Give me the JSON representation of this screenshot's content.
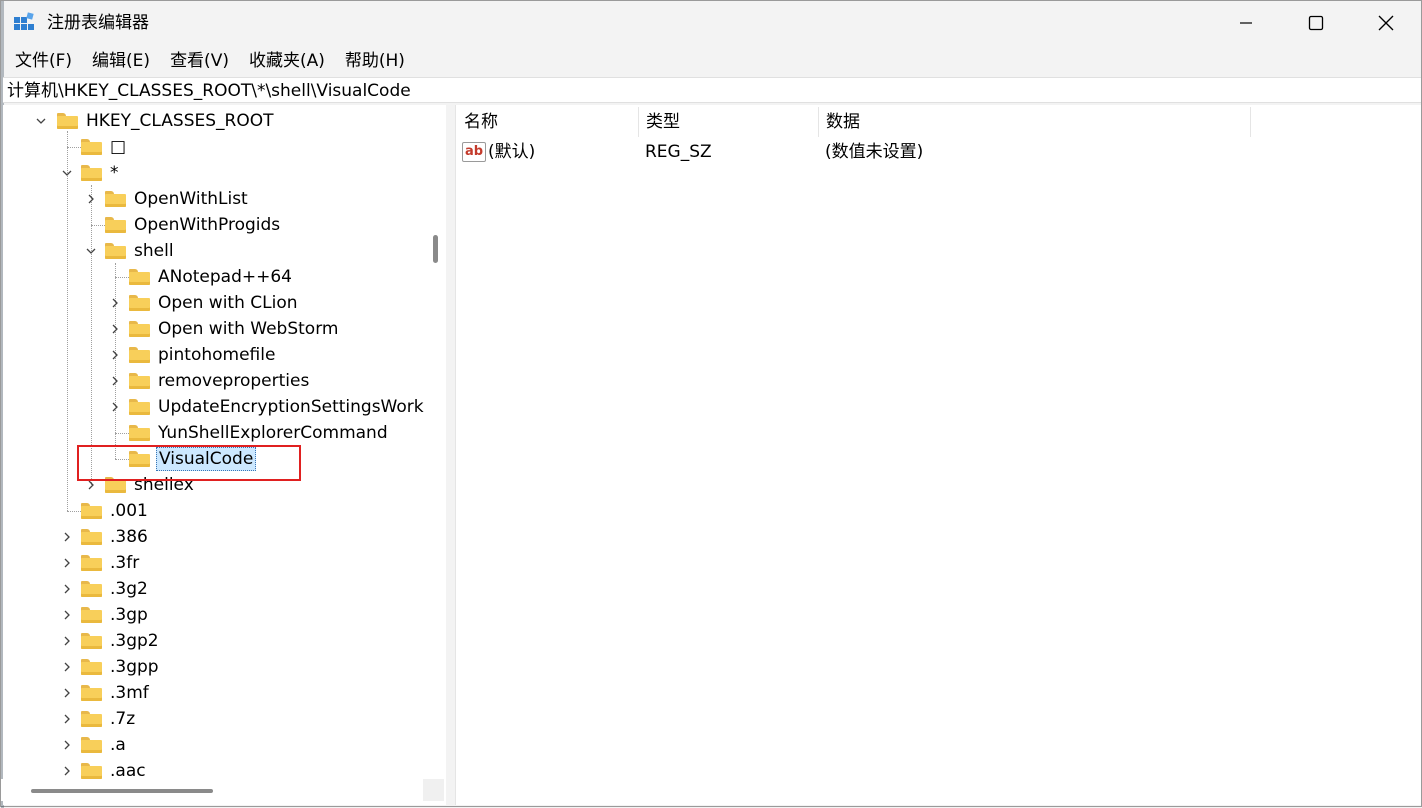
{
  "window": {
    "title": "注册表编辑器",
    "icon": "regedit-icon"
  },
  "menu": [
    "文件(F)",
    "编辑(E)",
    "查看(V)",
    "收藏夹(A)",
    "帮助(H)"
  ],
  "address": "计算机\\HKEY_CLASSES_ROOT\\*\\shell\\VisualCode",
  "tree": {
    "root": "HKEY_CLASSES_ROOT",
    "nodes": [
      {
        "label": "□",
        "expander": "none"
      },
      {
        "label": "*",
        "expander": "expanded"
      },
      {
        "label": "OpenWithList",
        "expander": "collapsed"
      },
      {
        "label": "OpenWithProgids",
        "expander": "none"
      },
      {
        "label": "shell",
        "expander": "expanded"
      },
      {
        "label": "ANotepad++64",
        "expander": "none"
      },
      {
        "label": "Open with CLion",
        "expander": "collapsed"
      },
      {
        "label": "Open with WebStorm",
        "expander": "collapsed"
      },
      {
        "label": "pintohomefile",
        "expander": "collapsed"
      },
      {
        "label": "removeproperties",
        "expander": "collapsed"
      },
      {
        "label": "UpdateEncryptionSettingsWork",
        "expander": "collapsed"
      },
      {
        "label": "YunShellExplorerCommand",
        "expander": "none"
      },
      {
        "label": "VisualCode",
        "expander": "none",
        "selected": true
      },
      {
        "label": "shellex",
        "expander": "collapsed"
      },
      {
        "label": ".001",
        "expander": "none"
      },
      {
        "label": ".386",
        "expander": "collapsed"
      },
      {
        "label": ".3fr",
        "expander": "collapsed"
      },
      {
        "label": ".3g2",
        "expander": "collapsed"
      },
      {
        "label": ".3gp",
        "expander": "collapsed"
      },
      {
        "label": ".3gp2",
        "expander": "collapsed"
      },
      {
        "label": ".3gpp",
        "expander": "collapsed"
      },
      {
        "label": ".3mf",
        "expander": "collapsed"
      },
      {
        "label": ".7z",
        "expander": "collapsed"
      },
      {
        "label": ".a",
        "expander": "collapsed"
      },
      {
        "label": ".aac",
        "expander": "collapsed"
      }
    ]
  },
  "list": {
    "columns": [
      "名称",
      "类型",
      "数据"
    ],
    "rows": [
      {
        "name": "(默认)",
        "type": "REG_SZ",
        "data": "(数值未设置)",
        "icon": "string-value-icon"
      }
    ]
  },
  "colors": {
    "selection": "#cce8ff",
    "highlight_box": "#e02020",
    "folder": "#f8cf5a"
  }
}
